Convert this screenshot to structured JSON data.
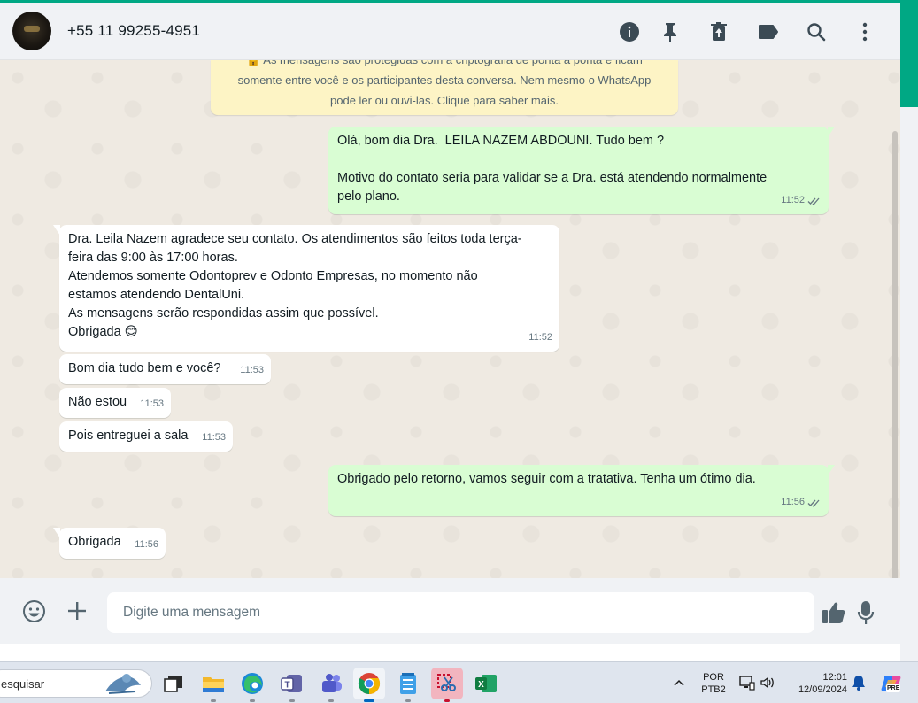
{
  "header": {
    "contact_name": "+55 11 99255-4951",
    "icons": [
      "info-icon",
      "pin-icon",
      "delete-icon",
      "label-icon",
      "search-icon",
      "menu-icon"
    ]
  },
  "encryption_notice": {
    "line1": "🔒 As mensagens são protegidas com a criptografia de ponta a ponta e ficam",
    "line2": "somente entre você e os participantes desta conversa. Nem mesmo o WhatsApp",
    "line3": "pode ler ou ouvi-las. Clique para saber mais."
  },
  "messages": [
    {
      "direction": "out",
      "text": "Olá, bom dia Dra.  LEILA NAZEM ABDOUNI. Tudo bem ?\n\nMotivo do contato seria para validar se a Dra. está atendendo normalmente\npelo plano.",
      "time": "11:52",
      "status": "read"
    },
    {
      "direction": "in",
      "text": "Dra. Leila Nazem agradece seu contato. Os atendimentos são feitos toda terça-\nfeira das 9:00 às 17:00 horas.\nAtendemos somente Odontoprev e Odonto Empresas, no momento não\nestamos atendendo DentalUni.\nAs mensagens serão respondidas assim que possível.\nObrigada 😊",
      "time": "11:52"
    },
    {
      "direction": "in",
      "text": "Bom dia tudo bem e você?",
      "time": "11:53"
    },
    {
      "direction": "in",
      "text": "Não estou",
      "time": "11:53"
    },
    {
      "direction": "in",
      "text": "Pois entreguei a sala",
      "time": "11:53"
    },
    {
      "direction": "out",
      "text": "Obrigado pelo retorno, vamos seguir com a tratativa. Tenha um ótimo dia.",
      "time": "11:56",
      "status": "read"
    },
    {
      "direction": "in",
      "text": "Obrigada",
      "time": "11:56"
    }
  ],
  "composer": {
    "placeholder": "Digite uma mensagem",
    "icons": [
      "emoji-icon",
      "attach-plus-icon",
      "thumbs-up-icon",
      "microphone-icon"
    ]
  },
  "taskbar": {
    "search_text": "esquisar",
    "apps": [
      "task-view",
      "file-explorer",
      "edge",
      "teams-work",
      "teams",
      "chrome",
      "notepad",
      "snipping-tool",
      "excel"
    ],
    "language_line1": "POR",
    "language_line2": "PTB2",
    "time": "12:01",
    "date": "12/09/2024",
    "copilot_badge": "PRE"
  },
  "colors": {
    "accent": "#00a884",
    "outgoing_bubble": "#d9fdd3",
    "incoming_bubble": "#ffffff",
    "chat_background": "#efeae2",
    "notice_background": "#fdf4c5",
    "read_ticks": "#667781"
  }
}
